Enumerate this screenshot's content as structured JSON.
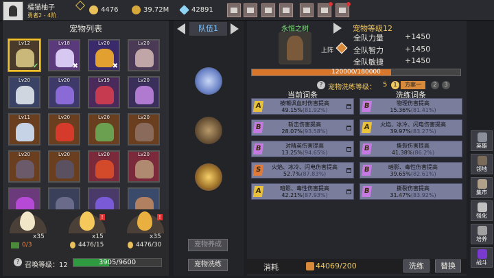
{
  "player": {
    "name": "橘猫柚子",
    "rank": "勇者2 - 4阶"
  },
  "resources": [
    {
      "name": "gold-egg-icon",
      "color": "#e9c05a",
      "value": "4476"
    },
    {
      "name": "coin-icon",
      "color": "#d6a73a",
      "value": "39.72M"
    },
    {
      "name": "diamond-icon",
      "color": "#8fd3f5",
      "value": "42891"
    }
  ],
  "toolbar": [
    "shop-icon",
    "mail-icon",
    "gamepad-icon",
    "settings-gear-icon",
    "gift-icon",
    "wheel-icon",
    "bag-icon"
  ],
  "pet_list": {
    "title": "宠物列表",
    "pets": [
      {
        "lv": "Lv12",
        "color": "#c9b87a",
        "bg": "#4a3a2a",
        "mark": "✔",
        "selected": true
      },
      {
        "lv": "Lv18",
        "color": "#d6c8f0",
        "bg": "#5a3a7a",
        "mark": "✖"
      },
      {
        "lv": "Lv20",
        "color": "#e2a030",
        "bg": "#3a2a6a",
        "mark": "✖"
      },
      {
        "lv": "Lv20",
        "color": "#c0a6a6",
        "bg": "#4a3a55",
        "mark": ""
      },
      {
        "lv": "Lv20",
        "color": "#d0d6e0",
        "bg": "#3a4266",
        "mark": ""
      },
      {
        "lv": "Lv20",
        "color": "#8a6ad6",
        "bg": "#3d3a6a",
        "mark": ""
      },
      {
        "lv": "Lv19",
        "color": "#c73b50",
        "bg": "#4a2a5a",
        "mark": ""
      },
      {
        "lv": "Lv20",
        "color": "#b07ad0",
        "bg": "#3a2f5a",
        "mark": ""
      },
      {
        "lv": "Lv11",
        "color": "#c6d2e6",
        "bg": "#6a3f20",
        "mark": ""
      },
      {
        "lv": "Lv20",
        "color": "#d63a2a",
        "bg": "#6a3f20",
        "mark": ""
      },
      {
        "lv": "Lv20",
        "color": "#6aa050",
        "bg": "#6a3f20",
        "mark": ""
      },
      {
        "lv": "Lv20",
        "color": "#8a6a5a",
        "bg": "#6a3f20",
        "mark": ""
      },
      {
        "lv": "Lv20",
        "color": "#6a5a6a",
        "bg": "#6a3f20",
        "mark": ""
      },
      {
        "lv": "Lv20",
        "color": "#5a5060",
        "bg": "#6a3f20",
        "mark": ""
      },
      {
        "lv": "Lv20",
        "color": "#d24a2a",
        "bg": "#7a2a3a",
        "mark": ""
      },
      {
        "lv": "Lv20",
        "color": "#b08a70",
        "bg": "#7a2a3a",
        "mark": ""
      },
      {
        "lv": "",
        "color": "#b64ad6",
        "bg": "#6a3a7a",
        "mark": ""
      },
      {
        "lv": "",
        "color": "#6a6a8a",
        "bg": "#3a3f5a",
        "mark": ""
      },
      {
        "lv": "",
        "color": "#7a5ad6",
        "bg": "#4a3a6a",
        "mark": ""
      },
      {
        "lv": "",
        "color": "#b08060",
        "bg": "#3a4a6a",
        "mark": ""
      }
    ]
  },
  "eggs": [
    {
      "color": "#f1e6c8",
      "count": "x35",
      "have": "0/3",
      "alert": false
    },
    {
      "color": "#f4c85a",
      "count": "x15",
      "have": "4476/15",
      "alert": true
    },
    {
      "color": "#e9b040",
      "count": "x35",
      "have": "4476/30",
      "alert": true
    }
  ],
  "summon": {
    "label": "召唤等级：12",
    "progress_text": "3905/9600",
    "progress": 0.407
  },
  "team": {
    "tab": "队伍1",
    "slots": [
      {
        "color": "#9fb4e6"
      },
      {
        "color": "#a08a5a"
      },
      {
        "color": "#d6a84a"
      }
    ],
    "btn_evolve": "宠物养成",
    "btn_wash": "宠物洗练"
  },
  "pet_detail": {
    "name": "永恒之树",
    "level": "宠物等级12",
    "deploy": "上阵",
    "stats": [
      {
        "label": "全队力量",
        "value": "+1450"
      },
      {
        "label": "全队智力",
        "value": "+1450"
      },
      {
        "label": "全队敏捷",
        "value": "+1450"
      }
    ],
    "hp_text": "120000/180000",
    "hp_ratio": 0.667
  },
  "wash": {
    "title": "宠物洗练等级：",
    "level": "5",
    "scheme_1": "1",
    "scheme_1_label": "方案一",
    "scheme_2": "2",
    "scheme_3": "3",
    "current_header": "当前词条",
    "new_header": "洗练词条",
    "current": [
      {
        "gem": "A",
        "gcolor": "#e8c23a",
        "line1": "被嘲讽血时伤害提高",
        "line2": "49.15%(81.92%)",
        "v2color": "#ffd46a"
      },
      {
        "gem": "B",
        "gcolor": "#c47ae0",
        "line1": "斩击伤害提高",
        "line2": "28.07%(93.58%)",
        "v2color": "#6ad4ff"
      },
      {
        "gem": "B",
        "gcolor": "#c47ae0",
        "line1": "对精英伤害提高",
        "line2": "13.25%(94.65%)",
        "v2color": "#6ad4ff"
      },
      {
        "gem": "S",
        "gcolor": "#e07a3a",
        "line1": "火焰、冰冷、闪电伤害提高",
        "line2": "52.7%(87.83%)",
        "v2color": "#ffd46a"
      },
      {
        "gem": "A",
        "gcolor": "#e8c23a",
        "line1": "暗影、毒性伤害提高",
        "line2": "42.21%(87.93%)",
        "v2color": "#ffd46a"
      }
    ],
    "washed": [
      {
        "gem": "B",
        "gcolor": "#c47ae0",
        "line1": "物理伤害提高",
        "line2": "15.36%(81.41%)",
        "v2color": "#ff8fb0"
      },
      {
        "gem": "A",
        "gcolor": "#e8c23a",
        "line1": "火焰、冰冷、闪电伤害提高",
        "line2": "39.97%(83.27%)",
        "v2color": "#ffd46a"
      },
      {
        "gem": "B",
        "gcolor": "#c47ae0",
        "line1": "撕裂伤害提高",
        "line2": "41.38%(86.2%)",
        "v2color": "#ffd46a"
      },
      {
        "gem": "B",
        "gcolor": "#c47ae0",
        "line1": "暗影、毒性伤害提高",
        "line2": "39.65%(82.61%)",
        "v2color": "#ffd46a"
      },
      {
        "gem": "B",
        "gcolor": "#c47ae0",
        "line1": "撕裂伤害提高",
        "line2": "31.47%(83.92%)",
        "v2color": "#ff8fb0"
      }
    ]
  },
  "cost": {
    "label": "消耗",
    "value": "44069/200"
  },
  "actions": {
    "wash": "洗练",
    "replace": "替换"
  },
  "side_menu": [
    {
      "icon": "hero-helmet-icon",
      "label": "英雄",
      "color": "#8a8f9a"
    },
    {
      "icon": "territory-icon",
      "label": "领地",
      "color": "#7a6a5a"
    },
    {
      "icon": "market-icon",
      "label": "集市",
      "color": "#b0a08a"
    },
    {
      "icon": "strengthen-icon",
      "label": "强化",
      "color": "#c0c0c0"
    },
    {
      "icon": "cultivate-icon",
      "label": "培养",
      "color": "#a0a0a0"
    },
    {
      "icon": "battle-icon",
      "label": "战斗",
      "color": "#7a3ad0"
    }
  ]
}
